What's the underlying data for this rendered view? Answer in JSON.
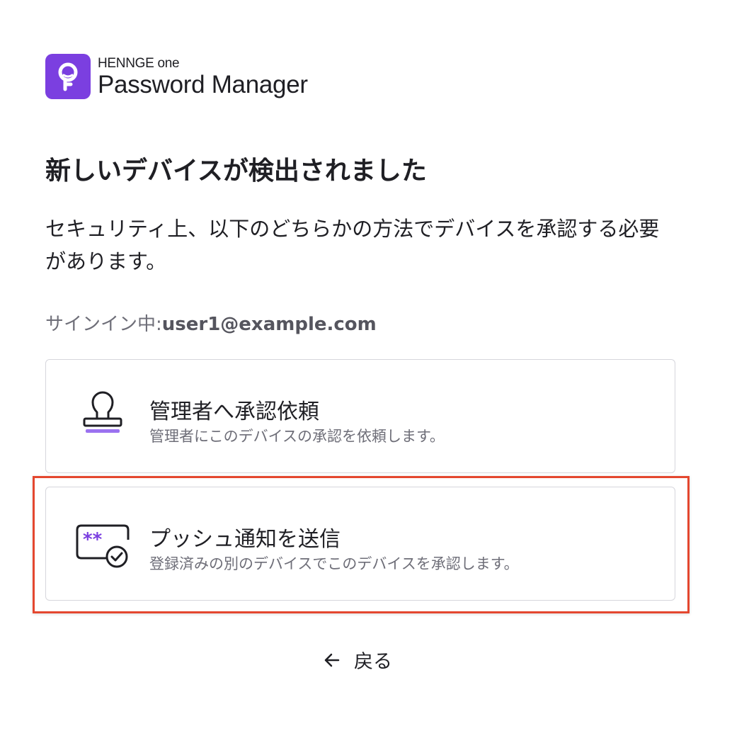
{
  "brand": {
    "company": "HENNGE one",
    "product": "Password Manager",
    "accent_color": "#7b3fe0",
    "icon": "key-logo-icon"
  },
  "title": "新しいデバイスが検出されました",
  "description": "セキュリティ上、以下のどちらかの方法でデバイスを承認する必要があります。",
  "signed_in": {
    "label": "サインイン中:",
    "email": "user1@example.com"
  },
  "options": [
    {
      "icon": "stamp-icon",
      "title": "管理者へ承認依頼",
      "description": "管理者にこのデバイスの承認を依頼します。"
    },
    {
      "icon": "push-notification-icon",
      "title": "プッシュ通知を送信",
      "description": "登録済みの別のデバイスでこのデバイスを承認します。"
    }
  ],
  "highlight_color": "#e4472f",
  "back": {
    "icon": "arrow-left-icon",
    "label": "戻る"
  }
}
